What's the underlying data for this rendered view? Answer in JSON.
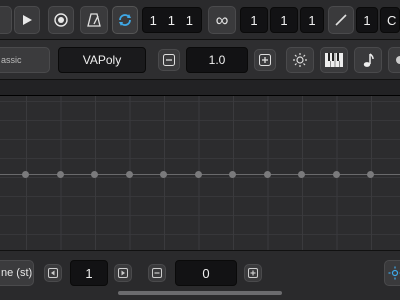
{
  "transport": {
    "position": "1   1   1",
    "loop_length_bars": "1",
    "loop_length_beats": "1",
    "loop_length_steps": "1",
    "step_value": "1",
    "cut_label": "C"
  },
  "instrument": {
    "preset_name": "assic",
    "synth_name": "VAPoly",
    "velocity_value": "1.0"
  },
  "bottom": {
    "param_label": "ne (st)",
    "step_index": "1",
    "param_value": "0"
  },
  "colors": {
    "accent": "#3fa9e8",
    "background": "#1c1c1e"
  }
}
